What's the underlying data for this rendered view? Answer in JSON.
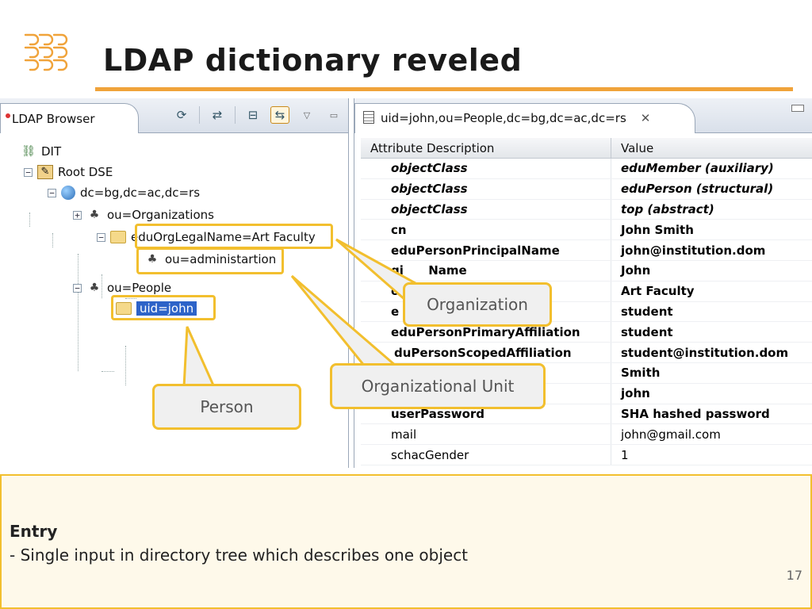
{
  "slide": {
    "title": "LDAP dictionary reveled",
    "page_number": "17",
    "colors": {
      "accent": "#f0a33a",
      "highlight": "#f2bf2e",
      "selection": "#2d63c8"
    }
  },
  "left_panel": {
    "tab_label": "LDAP Browser",
    "icons": [
      "refresh-icon",
      "link-icon",
      "collapse-icon",
      "sync-icon",
      "view-menu-icon",
      "minimize-icon"
    ],
    "tree": {
      "dit": "DIT",
      "root_dse": "Root DSE",
      "domain": "dc=bg,dc=ac,dc=rs",
      "organizations": "ou=Organizations",
      "org_legal": "eduOrgLegalName=Art Faculty",
      "admin_unit": "ou=administartion",
      "people": "ou=People",
      "uid": "uid=john"
    }
  },
  "right_panel": {
    "tab_label": "uid=john,ou=People,dc=bg,dc=ac,dc=rs",
    "columns": {
      "attribute": "Attribute Description",
      "value": "Value"
    },
    "rows": [
      {
        "attr": "objectClass",
        "value": "eduMember (auxiliary)"
      },
      {
        "attr": "objectClass",
        "value": "eduPerson (structural)"
      },
      {
        "attr": "objectClass",
        "value": "top (abstract)"
      },
      {
        "attr": "cn",
        "value": "John Smith"
      },
      {
        "attr": "eduPersonPrincipalName",
        "value": "john@institution.dom"
      },
      {
        "attr": "gi      Name",
        "value": "John"
      },
      {
        "attr": "o",
        "value": "Art Faculty"
      },
      {
        "attr": "e",
        "value": "student"
      },
      {
        "attr": "eduPersonPrimaryAffiliation",
        "value": "student"
      },
      {
        "attr": "duPersonScopedAffiliation",
        "value": "student@institution.dom"
      },
      {
        "attr": "",
        "value": "Smith"
      },
      {
        "attr": "",
        "value": "john"
      },
      {
        "attr": "userPassword",
        "value": "SHA hashed password"
      },
      {
        "attr": "mail",
        "value": "john@gmail.com"
      },
      {
        "attr": "schacGender",
        "value": "1"
      }
    ]
  },
  "callouts": {
    "organization": "Organization",
    "organizational_unit": "Organizational Unit",
    "person": "Person"
  },
  "caption": {
    "title": "Entry",
    "text": "- Single input in directory tree which describes one object"
  }
}
